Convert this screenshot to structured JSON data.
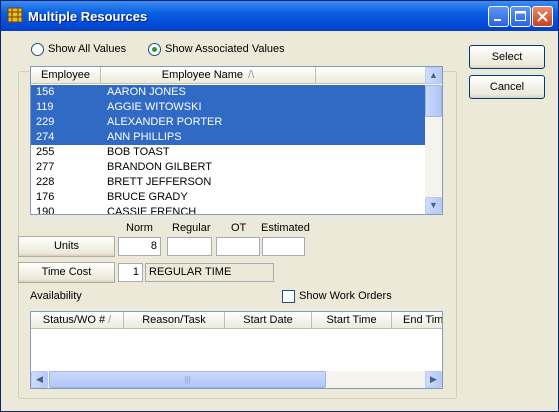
{
  "window": {
    "title": "Multiple Resources"
  },
  "radios": {
    "all_label": "Show All Values",
    "associated_label": "Show Associated Values",
    "selected": "associated"
  },
  "buttons": {
    "select": "Select",
    "cancel": "Cancel",
    "units": "Units",
    "time_cost": "Time Cost"
  },
  "employee_grid": {
    "columns": [
      "Employee",
      "Employee Name"
    ],
    "sort_indicator": "/\\",
    "rows": [
      {
        "id": "156",
        "name": "AARON JONES",
        "selected": true
      },
      {
        "id": "119",
        "name": "AGGIE WITOWSKI",
        "selected": true
      },
      {
        "id": "229",
        "name": "ALEXANDER PORTER",
        "selected": true
      },
      {
        "id": "274",
        "name": "ANN PHILLIPS",
        "selected": true
      },
      {
        "id": "255",
        "name": "BOB TOAST",
        "selected": false
      },
      {
        "id": "277",
        "name": "BRANDON GILBERT",
        "selected": false
      },
      {
        "id": "228",
        "name": "BRETT JEFFERSON",
        "selected": false
      },
      {
        "id": "176",
        "name": "BRUCE GRADY",
        "selected": false
      },
      {
        "id": "190",
        "name": "CASSIE FRENCH",
        "selected": false
      }
    ]
  },
  "units": {
    "headers": [
      "Norm",
      "Regular",
      "OT",
      "Estimated"
    ],
    "norm_value": "8",
    "regular_value": "",
    "ot_value": "",
    "estimated_value": ""
  },
  "time_cost": {
    "code": "1",
    "description": "REGULAR TIME"
  },
  "availability": {
    "label": "Availability",
    "show_work_orders_label": "Show Work Orders",
    "columns": [
      "Status/WO #",
      "Reason/Task",
      "Start Date",
      "Start Time",
      "End Tim"
    ],
    "sort_indicator": "/"
  },
  "scroll_glyphs": {
    "up": "▲",
    "down": "▼",
    "left": "◀",
    "right": "▶",
    "grip": "|||"
  }
}
